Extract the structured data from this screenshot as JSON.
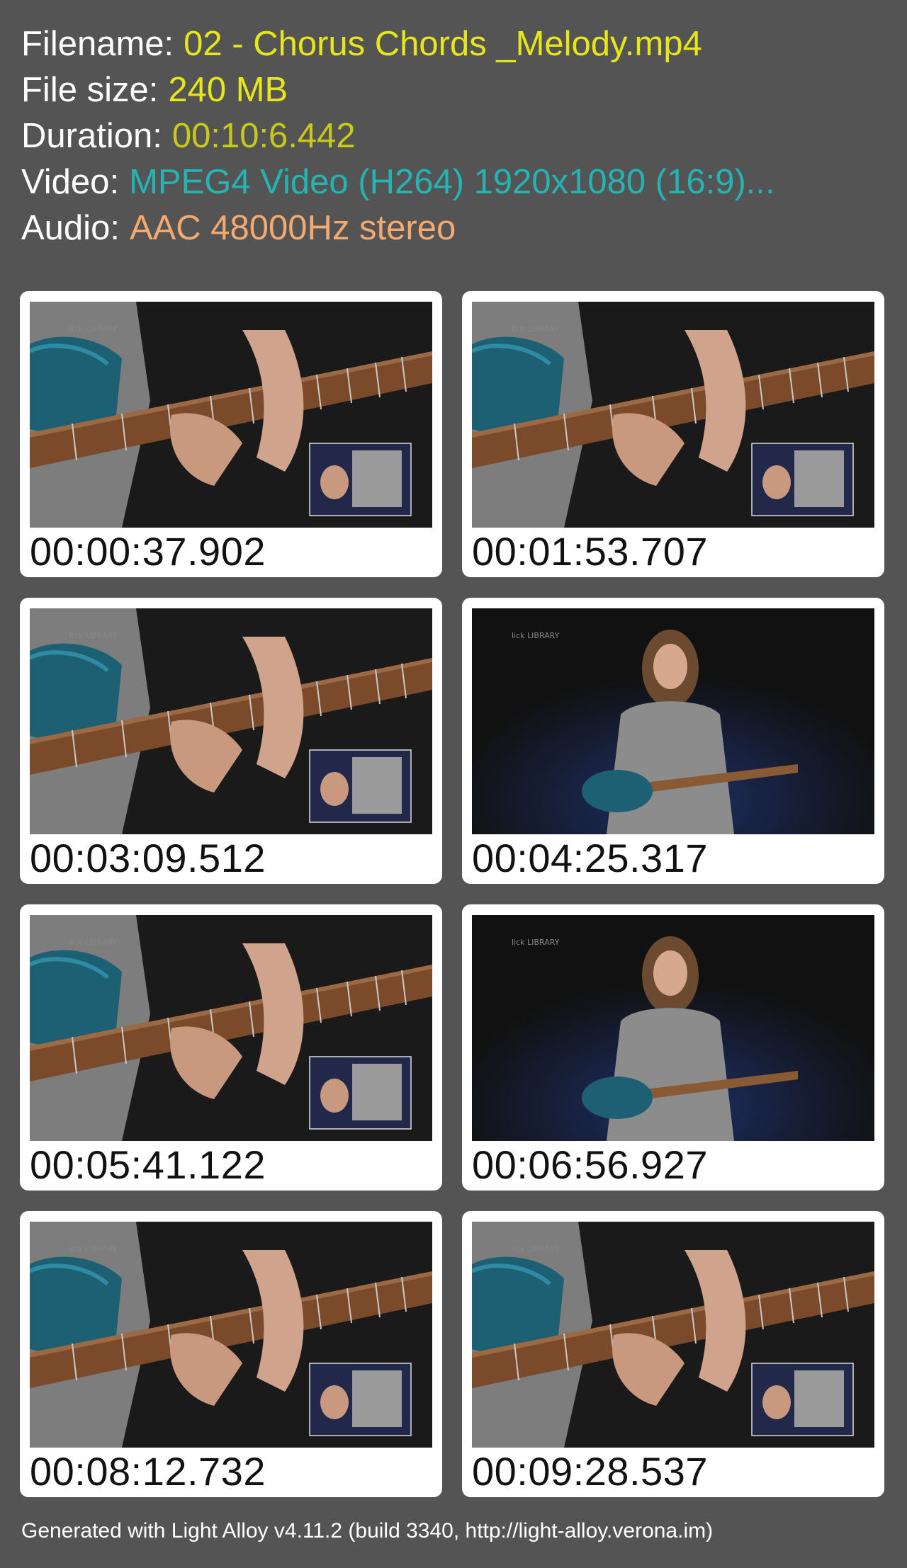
{
  "info": {
    "filename_label": "Filename:",
    "filename_value": "02 - Chorus Chords _Melody.mp4",
    "filesize_label": "File size:",
    "filesize_value": "240 MB",
    "duration_label": "Duration:",
    "duration_value": "00:10:6.442",
    "video_label": "Video:",
    "video_value": "MPEG4 Video (H264) 1920x1080 (16:9)...",
    "audio_label": "Audio:",
    "audio_value": "AAC 48000Hz stereo"
  },
  "colors": {
    "background": "#545454",
    "label": "#ffffff",
    "filename": "#e6e619",
    "filesize": "#e6e619",
    "duration": "#c9c918",
    "video": "#23b4b4",
    "audio": "#f4a96f"
  },
  "thumbnails": [
    {
      "timestamp": "00:00:37.902",
      "scene": "closeup",
      "watermark": "lick LIBRARY"
    },
    {
      "timestamp": "00:01:53.707",
      "scene": "closeup",
      "watermark": "lick LIBRARY"
    },
    {
      "timestamp": "00:03:09.512",
      "scene": "closeup",
      "watermark": "lick LIBRARY"
    },
    {
      "timestamp": "00:04:25.317",
      "scene": "wide",
      "watermark": "lick LIBRARY"
    },
    {
      "timestamp": "00:05:41.122",
      "scene": "closeup",
      "watermark": "lick LIBRARY"
    },
    {
      "timestamp": "00:06:56.927",
      "scene": "wide",
      "watermark": "lick LIBRARY"
    },
    {
      "timestamp": "00:08:12.732",
      "scene": "closeup",
      "watermark": "lick LIBRARY"
    },
    {
      "timestamp": "00:09:28.537",
      "scene": "closeup",
      "watermark": "lick LIBRARY"
    }
  ],
  "footer": {
    "text": "Generated with Light Alloy v4.11.2 (build 3340, http://light-alloy.verona.im)"
  }
}
